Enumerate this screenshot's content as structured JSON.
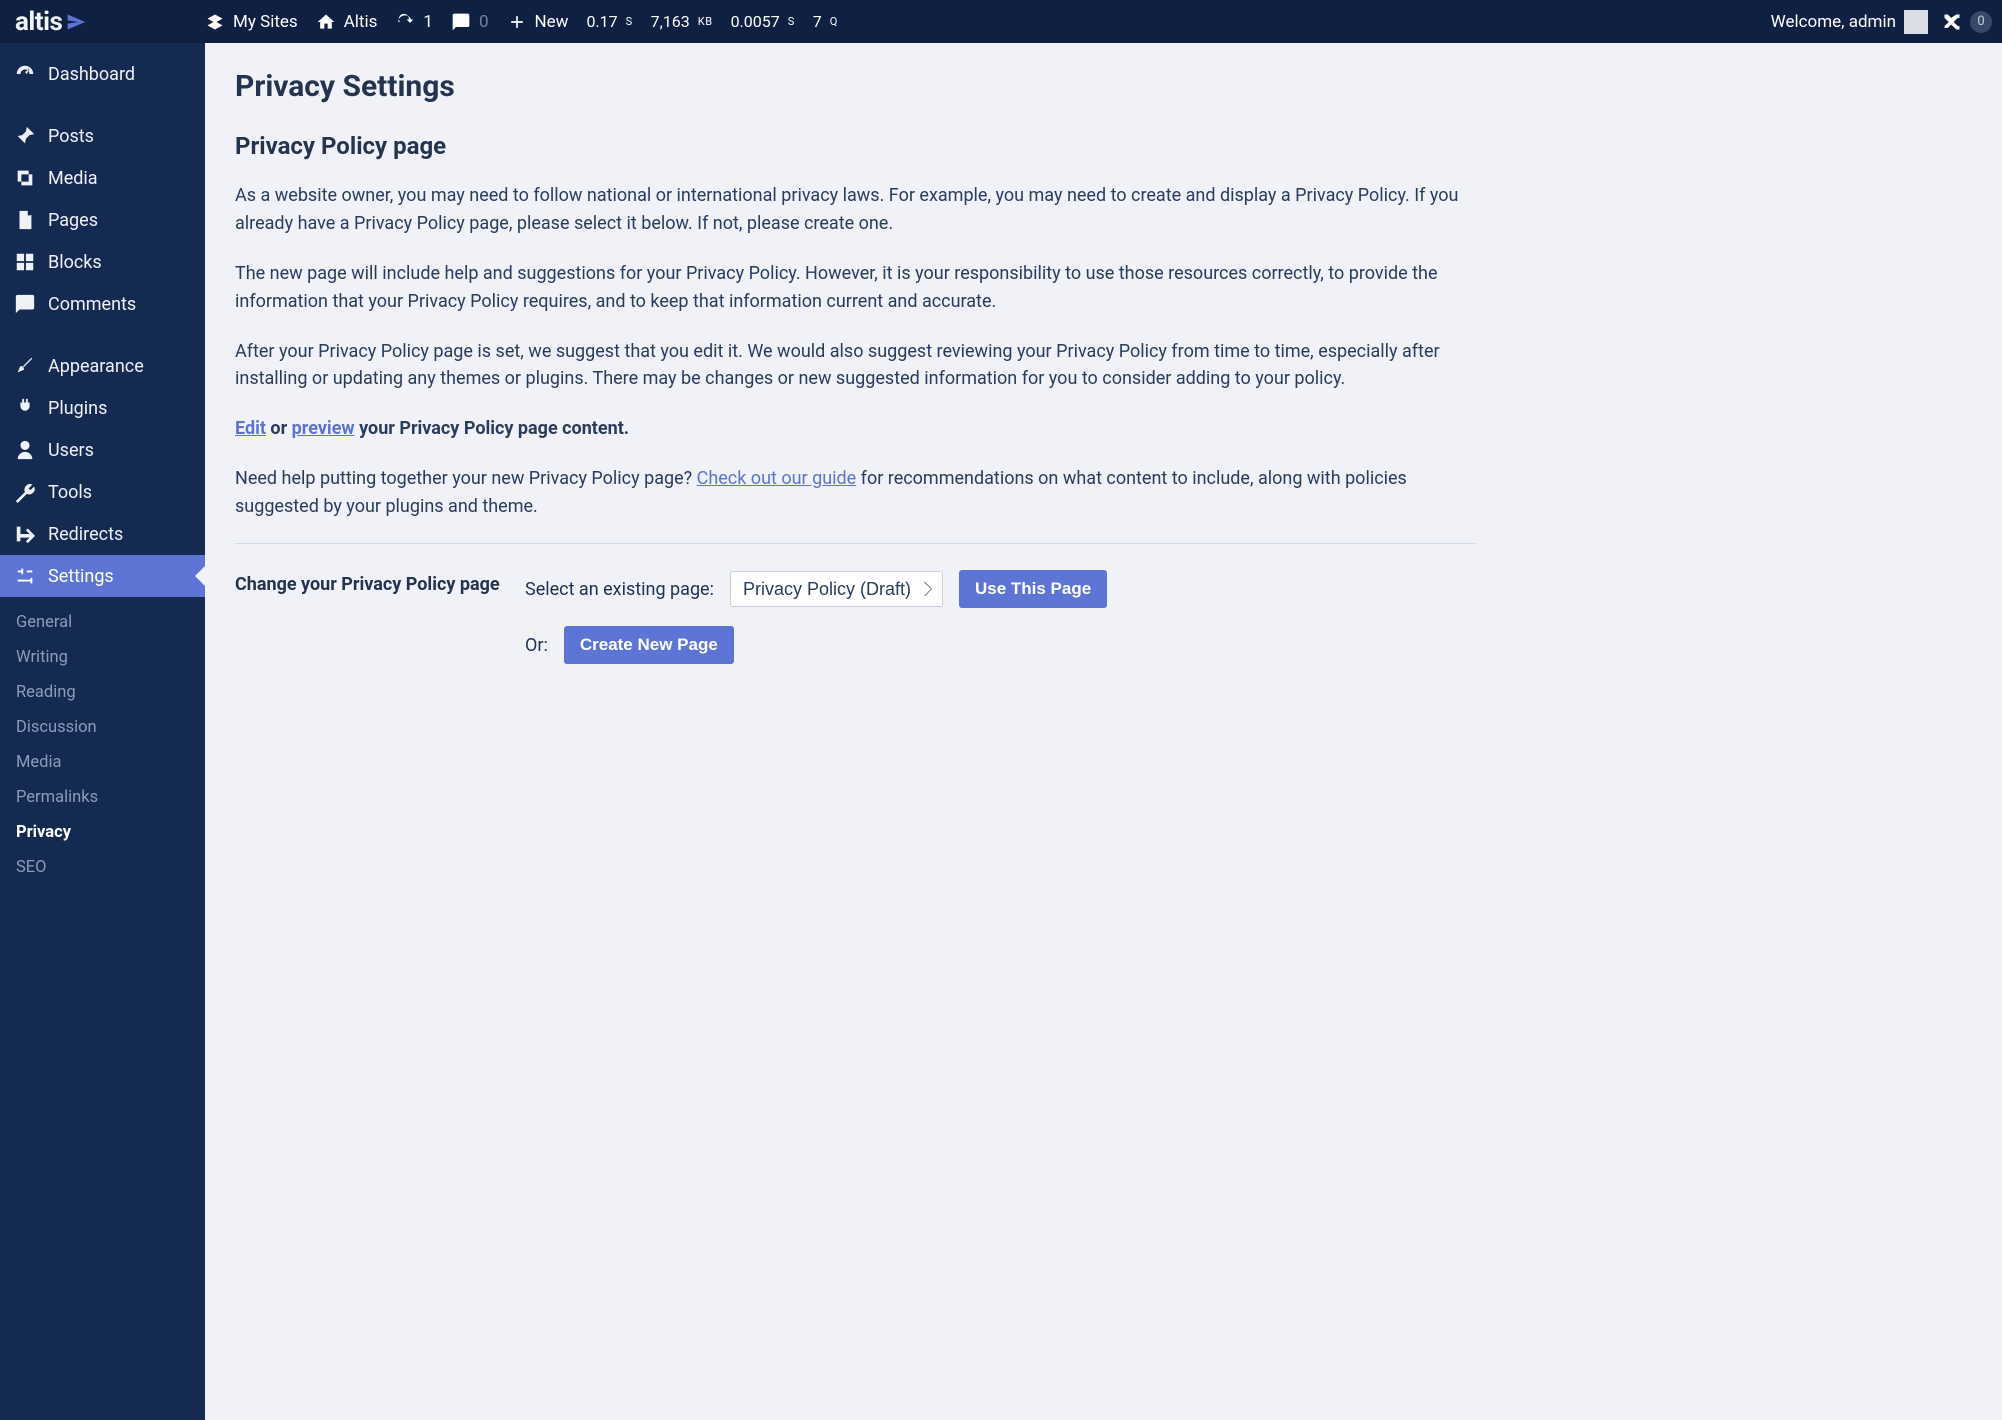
{
  "brand": {
    "name": "altis"
  },
  "adminbar": {
    "my_sites": "My Sites",
    "site_name": "Altis",
    "updates": "1",
    "comments": "0",
    "new": "New",
    "stat_time": "0.17",
    "stat_time_unit": "S",
    "stat_mem": "7,163",
    "stat_mem_unit": "KB",
    "stat_time2": "0.0057",
    "stat_time2_unit": "S",
    "stat_q": "7",
    "stat_q_unit": "Q",
    "welcome": "Welcome, admin",
    "shuffle_badge": "0"
  },
  "sidebar": {
    "items": [
      {
        "icon": "dashboard",
        "label": "Dashboard"
      },
      {
        "icon": "pin",
        "label": "Posts"
      },
      {
        "icon": "media",
        "label": "Media"
      },
      {
        "icon": "pages",
        "label": "Pages"
      },
      {
        "icon": "blocks",
        "label": "Blocks"
      },
      {
        "icon": "comment",
        "label": "Comments"
      },
      {
        "icon": "appearance",
        "label": "Appearance"
      },
      {
        "icon": "plugins",
        "label": "Plugins"
      },
      {
        "icon": "users",
        "label": "Users"
      },
      {
        "icon": "tools",
        "label": "Tools"
      },
      {
        "icon": "redirect",
        "label": "Redirects"
      },
      {
        "icon": "settings",
        "label": "Settings"
      }
    ],
    "settings_sub": [
      "General",
      "Writing",
      "Reading",
      "Discussion",
      "Media",
      "Permalinks",
      "Privacy",
      "SEO"
    ]
  },
  "page": {
    "title": "Privacy Settings",
    "section_title": "Privacy Policy page",
    "p1": "As a website owner, you may need to follow national or international privacy laws. For example, you may need to create and display a Privacy Policy. If you already have a Privacy Policy page, please select it below. If not, please create one.",
    "p2": "The new page will include help and suggestions for your Privacy Policy. However, it is your responsibility to use those resources correctly, to provide the information that your Privacy Policy requires, and to keep that information current and accurate.",
    "p3": "After your Privacy Policy page is set, we suggest that you edit it. We would also suggest reviewing your Privacy Policy from time to time, especially after installing or updating any themes or plugins. There may be changes or new suggested information for you to consider adding to your policy.",
    "edit_link": "Edit",
    "or_word": " or ",
    "preview_link": "preview",
    "edit_trail": " your Privacy Policy page content.",
    "help_pre": "Need help putting together your new Privacy Policy page? ",
    "guide_link": "Check out our guide",
    "help_post": " for recommendations on what content to include, along with policies suggested by your plugins and theme.",
    "change_label": "Change your Privacy Policy page",
    "select_label": "Select an existing page:",
    "select_value": "Privacy Policy (Draft)",
    "use_button": "Use This Page",
    "or_label": "Or:",
    "create_button": "Create New Page"
  }
}
